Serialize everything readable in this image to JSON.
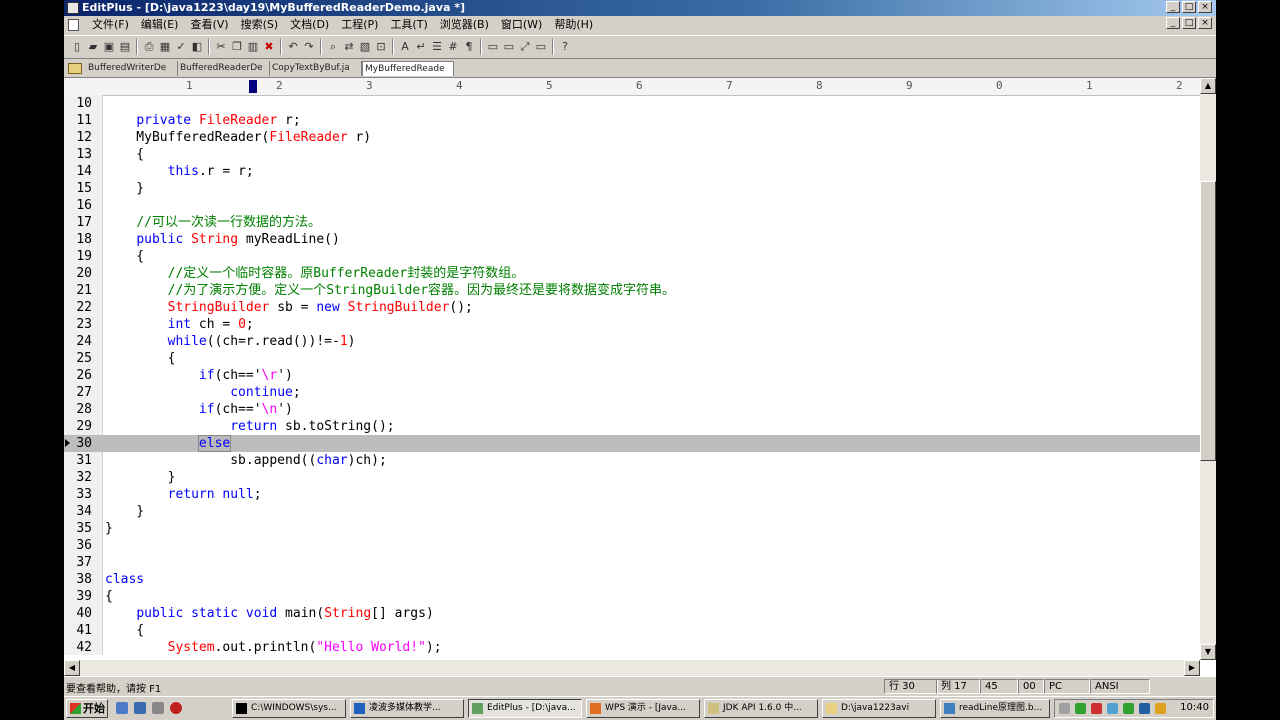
{
  "window": {
    "title": "EditPlus - [D:\\java1223\\day19\\MyBufferedReaderDemo.java *]",
    "min": "_",
    "max": "□",
    "close": "×"
  },
  "menu": [
    "文件(F)",
    "编辑(E)",
    "查看(V)",
    "搜索(S)",
    "文档(D)",
    "工程(P)",
    "工具(T)",
    "浏览器(B)",
    "窗口(W)",
    "帮助(H)"
  ],
  "tabs": [
    "BufferedWriterDe",
    "BufferedReaderDe",
    "CopyTextByBuf.ja",
    "MyBufferedReade"
  ],
  "ruler": [
    "1",
    "2",
    "3",
    "4",
    "5",
    "6",
    "7",
    "8",
    "9",
    "0",
    "1",
    "2"
  ],
  "code": [
    {
      "n": "10",
      "parts": []
    },
    {
      "n": "11",
      "parts": [
        {
          "t": "    "
        },
        {
          "t": "private",
          "c": "k"
        },
        {
          "t": " "
        },
        {
          "t": "FileReader",
          "c": "t"
        },
        {
          "t": " r;"
        }
      ]
    },
    {
      "n": "12",
      "parts": [
        {
          "t": "    MyBufferedReader("
        },
        {
          "t": "FileReader",
          "c": "t"
        },
        {
          "t": " r)"
        }
      ]
    },
    {
      "n": "13",
      "parts": [
        {
          "t": "    {"
        }
      ]
    },
    {
      "n": "14",
      "parts": [
        {
          "t": "        "
        },
        {
          "t": "this",
          "c": "k"
        },
        {
          "t": ".r = r;"
        }
      ]
    },
    {
      "n": "15",
      "parts": [
        {
          "t": "    }"
        }
      ]
    },
    {
      "n": "16",
      "parts": []
    },
    {
      "n": "17",
      "parts": [
        {
          "t": "    "
        },
        {
          "t": "//可以一次读一行数据的方法。",
          "c": "c"
        }
      ]
    },
    {
      "n": "18",
      "parts": [
        {
          "t": "    "
        },
        {
          "t": "public",
          "c": "k"
        },
        {
          "t": " "
        },
        {
          "t": "String",
          "c": "t"
        },
        {
          "t": " myReadLine()"
        }
      ]
    },
    {
      "n": "19",
      "parts": [
        {
          "t": "    {"
        }
      ]
    },
    {
      "n": "20",
      "parts": [
        {
          "t": "        "
        },
        {
          "t": "//定义一个临时容器。原BufferReader封装的是字符数组。",
          "c": "c"
        }
      ]
    },
    {
      "n": "21",
      "parts": [
        {
          "t": "        "
        },
        {
          "t": "//为了演示方便。定义一个StringBuilder容器。因为最终还是要将数据变成字符串。",
          "c": "c"
        }
      ]
    },
    {
      "n": "22",
      "parts": [
        {
          "t": "        "
        },
        {
          "t": "StringBuilder",
          "c": "t"
        },
        {
          "t": " sb = "
        },
        {
          "t": "new",
          "c": "k"
        },
        {
          "t": " "
        },
        {
          "t": "StringBuilder",
          "c": "t"
        },
        {
          "t": "();"
        }
      ]
    },
    {
      "n": "23",
      "parts": [
        {
          "t": "        "
        },
        {
          "t": "int",
          "c": "k"
        },
        {
          "t": " ch = "
        },
        {
          "t": "0",
          "c": "t"
        },
        {
          "t": ";"
        }
      ]
    },
    {
      "n": "24",
      "parts": [
        {
          "t": "        "
        },
        {
          "t": "while",
          "c": "k"
        },
        {
          "t": "((ch=r.read())!=-"
        },
        {
          "t": "1",
          "c": "t"
        },
        {
          "t": ")"
        }
      ]
    },
    {
      "n": "25",
      "parts": [
        {
          "t": "        {"
        }
      ]
    },
    {
      "n": "26",
      "parts": [
        {
          "t": "            "
        },
        {
          "t": "if",
          "c": "k"
        },
        {
          "t": "(ch=='"
        },
        {
          "t": "\\r",
          "c": "s"
        },
        {
          "t": "')"
        }
      ]
    },
    {
      "n": "27",
      "parts": [
        {
          "t": "                "
        },
        {
          "t": "continue",
          "c": "k"
        },
        {
          "t": ";"
        }
      ]
    },
    {
      "n": "28",
      "parts": [
        {
          "t": "            "
        },
        {
          "t": "if",
          "c": "k"
        },
        {
          "t": "(ch=='"
        },
        {
          "t": "\\n",
          "c": "s"
        },
        {
          "t": "')"
        }
      ]
    },
    {
      "n": "29",
      "parts": [
        {
          "t": "                "
        },
        {
          "t": "return",
          "c": "k"
        },
        {
          "t": " sb.toString();"
        }
      ]
    },
    {
      "n": "30",
      "parts": [
        {
          "t": "            "
        },
        {
          "t": "else",
          "c": "k sel"
        }
      ],
      "current": true
    },
    {
      "n": "31",
      "parts": [
        {
          "t": "                sb.append(("
        },
        {
          "t": "char",
          "c": "k"
        },
        {
          "t": ")ch);"
        }
      ]
    },
    {
      "n": "32",
      "parts": [
        {
          "t": "        }"
        }
      ]
    },
    {
      "n": "33",
      "parts": [
        {
          "t": "        "
        },
        {
          "t": "return",
          "c": "k"
        },
        {
          "t": " "
        },
        {
          "t": "null",
          "c": "k"
        },
        {
          "t": ";"
        }
      ]
    },
    {
      "n": "34",
      "parts": [
        {
          "t": "    }"
        }
      ]
    },
    {
      "n": "35",
      "parts": [
        {
          "t": "}"
        }
      ]
    },
    {
      "n": "36",
      "parts": []
    },
    {
      "n": "37",
      "parts": []
    },
    {
      "n": "38",
      "parts": [
        {
          "t": "class",
          "c": "k"
        }
      ]
    },
    {
      "n": "39",
      "parts": [
        {
          "t": "{"
        }
      ]
    },
    {
      "n": "40",
      "parts": [
        {
          "t": "    "
        },
        {
          "t": "public",
          "c": "k"
        },
        {
          "t": " "
        },
        {
          "t": "static",
          "c": "k"
        },
        {
          "t": " "
        },
        {
          "t": "void",
          "c": "k"
        },
        {
          "t": " main("
        },
        {
          "t": "String",
          "c": "t"
        },
        {
          "t": "[] args)"
        }
      ]
    },
    {
      "n": "41",
      "parts": [
        {
          "t": "    {"
        }
      ]
    },
    {
      "n": "42",
      "parts": [
        {
          "t": "        "
        },
        {
          "t": "System",
          "c": "t"
        },
        {
          "t": ".out.println("
        },
        {
          "t": "\"Hello World!\"",
          "c": "s"
        },
        {
          "t": ");"
        }
      ]
    }
  ],
  "status": {
    "help": "要查看帮助，请按 F1",
    "row": "行 30",
    "col": "列 17",
    "p1": "45",
    "p2": "00",
    "enc": "PC",
    "charset": "ANSI"
  },
  "taskbar": {
    "start": "开始",
    "tasks": [
      "C:\\WINDOWS\\sys...",
      "凌波多媒体教学...",
      "EditPlus - [D:\\java...",
      "WPS 演示 - [Java...",
      "JDK API 1.6.0 中...",
      "D:\\java1223avi",
      "readLine原理图.b..."
    ],
    "clock": "10:40"
  },
  "colors": {
    "keyword": "#0000ff",
    "type": "#ff0000",
    "comment": "#008000",
    "string": "#ff00ff",
    "current_line": "#bdbdbd"
  }
}
